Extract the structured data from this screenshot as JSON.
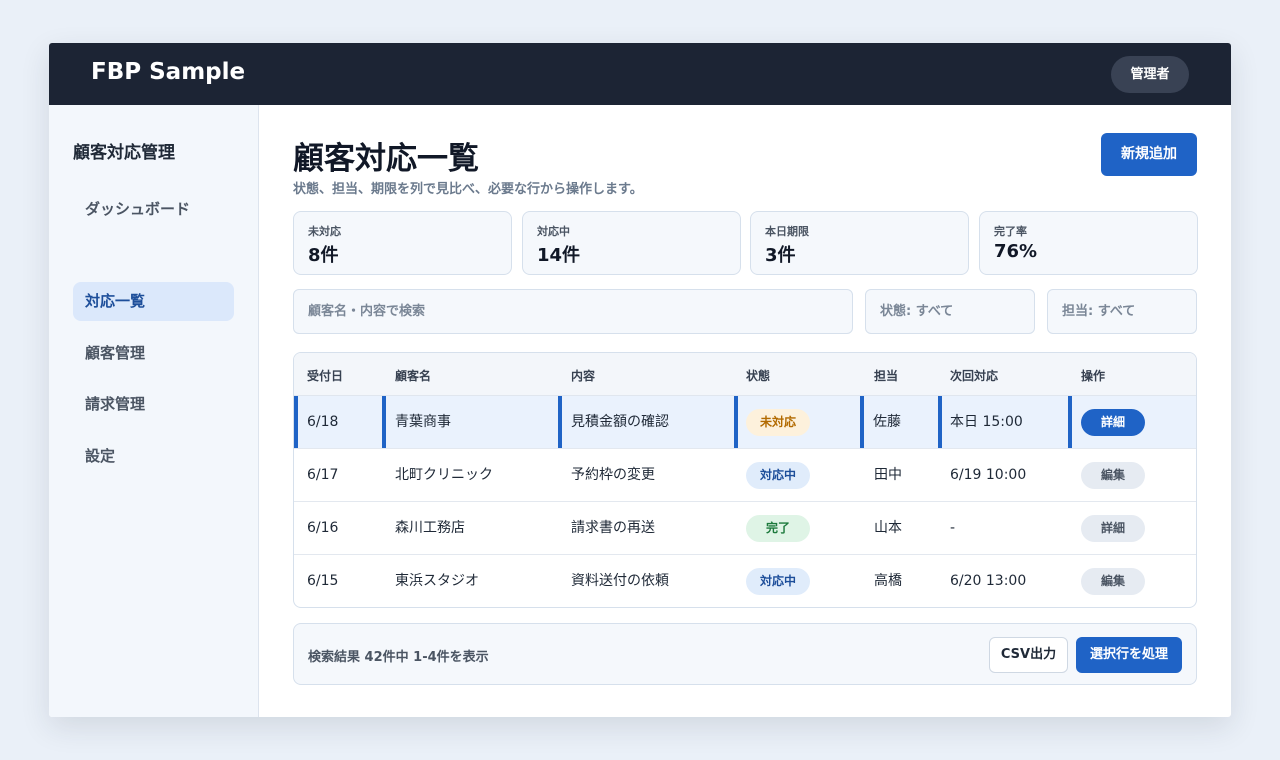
{
  "header": {
    "brand": "FBP Sample",
    "user_label": "管理者"
  },
  "sidebar": {
    "title": "顧客対応管理",
    "items": [
      {
        "label": "ダッシュボード",
        "active": false
      },
      {
        "label": "対応一覧",
        "active": true
      },
      {
        "label": "顧客管理",
        "active": false
      },
      {
        "label": "請求管理",
        "active": false
      },
      {
        "label": "設定",
        "active": false
      }
    ]
  },
  "page": {
    "title": "顧客対応一覧",
    "subtitle": "状態、担当、期限を列で見比べ、必要な行から操作します。",
    "add_button": "新規追加"
  },
  "stats": [
    {
      "label": "未対応",
      "value": "8件"
    },
    {
      "label": "対応中",
      "value": "14件"
    },
    {
      "label": "本日期限",
      "value": "3件"
    },
    {
      "label": "完了率",
      "value": "76%"
    }
  ],
  "filters": {
    "search_placeholder": "顧客名・内容で検索",
    "status_select": "状態: すべて",
    "assignee_select": "担当: すべて"
  },
  "table": {
    "columns": [
      "受付日",
      "顧客名",
      "内容",
      "状態",
      "担当",
      "次回対応",
      "操作"
    ],
    "rows": [
      {
        "date": "6/18",
        "customer": "青葉商事",
        "content": "見積金額の確認",
        "status": "未対応",
        "assignee": "佐藤",
        "next": "本日 15:00",
        "action": "詳細"
      },
      {
        "date": "6/17",
        "customer": "北町クリニック",
        "content": "予約枠の変更",
        "status": "対応中",
        "assignee": "田中",
        "next": "6/19 10:00",
        "action": "編集"
      },
      {
        "date": "6/16",
        "customer": "森川工務店",
        "content": "請求書の再送",
        "status": "完了",
        "assignee": "山本",
        "next": "-",
        "action": "詳細"
      },
      {
        "date": "6/15",
        "customer": "東浜スタジオ",
        "content": "資料送付の依頼",
        "status": "対応中",
        "assignee": "高橋",
        "next": "6/20 13:00",
        "action": "編集"
      }
    ]
  },
  "footer": {
    "result_text": "検索結果 42件中 1-4件を表示",
    "csv_button": "CSV出力",
    "process_button": "選択行を処理"
  },
  "colors": {
    "accent": "#1f63c6",
    "topbar": "#1c2434",
    "selected_row": "#eaf2fd"
  }
}
